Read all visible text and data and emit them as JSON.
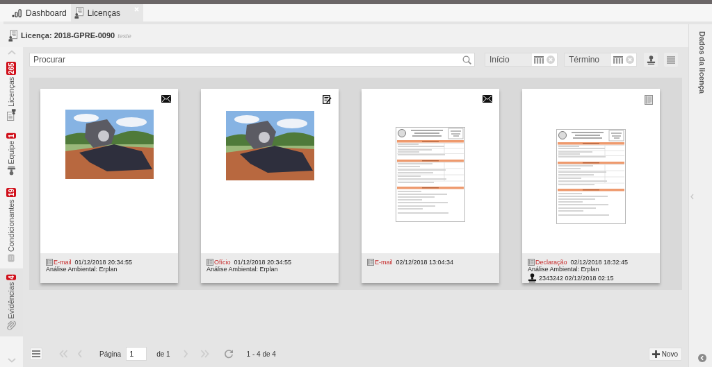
{
  "tabs": [
    {
      "kind": "dashboard",
      "label": "Dashboard",
      "selected": false,
      "closable": false
    },
    {
      "kind": "licenses",
      "label": "Licenças",
      "selected": true,
      "closable": true
    }
  ],
  "header": {
    "title": "Licença: 2018-GPRE-0090",
    "subtitle": "teste"
  },
  "sidebar": {
    "items": [
      {
        "kind": "licenses",
        "label": "Licenças",
        "badge": "265",
        "selected": false
      },
      {
        "kind": "team",
        "label": "Equipe",
        "badge": "1",
        "selected": false
      },
      {
        "kind": "conditions",
        "label": "Condicionantes",
        "badge": "19",
        "selected": false
      },
      {
        "kind": "evidence",
        "label": "Evidências",
        "badge": "4",
        "selected": true
      }
    ]
  },
  "toolbar": {
    "search": {
      "placeholder": "Procurar"
    },
    "date_filters": [
      {
        "placeholder": "Início"
      },
      {
        "placeholder": "Término"
      }
    ]
  },
  "cards": [
    {
      "kind": "email",
      "preview": {
        "kind": "photo"
      },
      "type": "E-mail",
      "date": "01/12/2018 20:34:55",
      "note": "Análise Ambiental: Erplan"
    },
    {
      "kind": "letter",
      "preview": {
        "kind": "photo"
      },
      "type": "Ofício",
      "date": "01/12/2018 20:34:55",
      "note": "Análise Ambiental: Erplan"
    },
    {
      "kind": "email",
      "preview": {
        "kind": "document"
      },
      "type": "E-mail",
      "date": "02/12/2018 13:04:34"
    },
    {
      "kind": "declaration",
      "preview": {
        "kind": "document"
      },
      "type": "Declaração",
      "date": "02/12/2018 18:32:45",
      "note": "Análise Ambiental: Erplan",
      "stamp": "2343242 02/12/2018 02:15"
    }
  ],
  "pager": {
    "back": [
      {
        "kind": "first",
        "disabled": true
      },
      {
        "kind": "prev",
        "disabled": true
      }
    ],
    "page_label": "Página",
    "page": "1",
    "of_label": "de 1",
    "forward": [
      {
        "kind": "next",
        "disabled": true
      },
      {
        "kind": "last",
        "disabled": true
      }
    ],
    "range": "1 - 4 de 4"
  },
  "new_button": {
    "label": "Novo"
  },
  "side_panel": {
    "title": "Dados da licença"
  }
}
